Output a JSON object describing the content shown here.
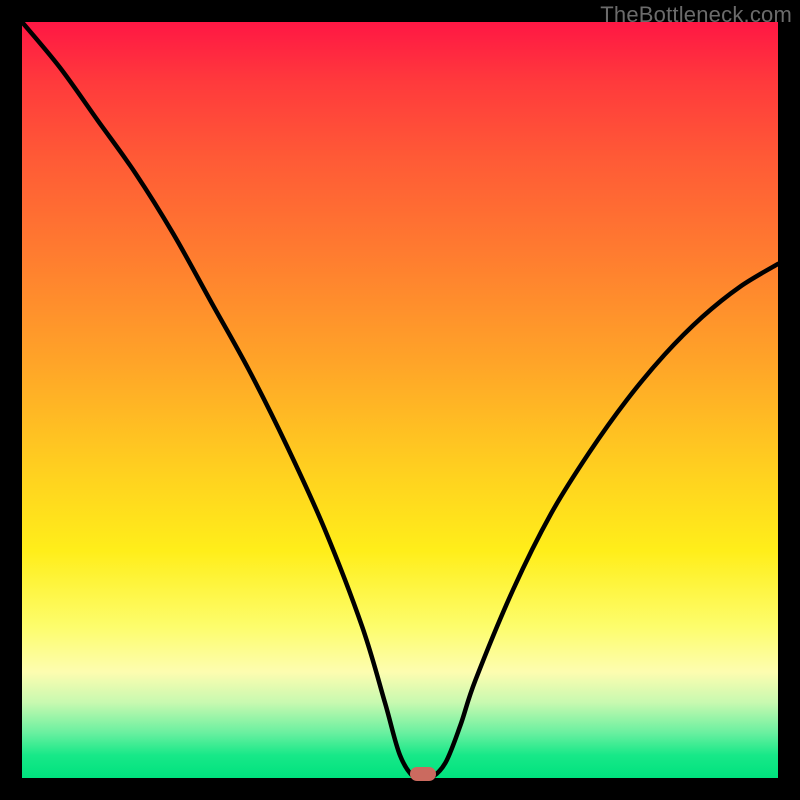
{
  "watermark": "TheBottleneck.com",
  "colors": {
    "frame": "#000000",
    "curve": "#000000",
    "marker": "#cb6a5f",
    "gradient_top": "#ff1744",
    "gradient_mid": "#ffd21f",
    "gradient_bottom": "#00e27e"
  },
  "chart_data": {
    "type": "line",
    "title": "",
    "xlabel": "",
    "ylabel": "",
    "xlim": [
      0,
      100
    ],
    "ylim": [
      0,
      100
    ],
    "annotations": [],
    "series": [
      {
        "name": "bottleneck-curve",
        "x": [
          0,
          5,
          10,
          15,
          20,
          25,
          30,
          35,
          40,
          45,
          48,
          50,
          52,
          54,
          56,
          58,
          60,
          65,
          70,
          75,
          80,
          85,
          90,
          95,
          100
        ],
        "y": [
          100,
          94,
          87,
          80,
          72,
          63,
          54,
          44,
          33,
          20,
          10,
          3,
          0,
          0,
          2,
          7,
          13,
          25,
          35,
          43,
          50,
          56,
          61,
          65,
          68
        ]
      }
    ],
    "marker": {
      "x": 53,
      "y": 0
    }
  }
}
